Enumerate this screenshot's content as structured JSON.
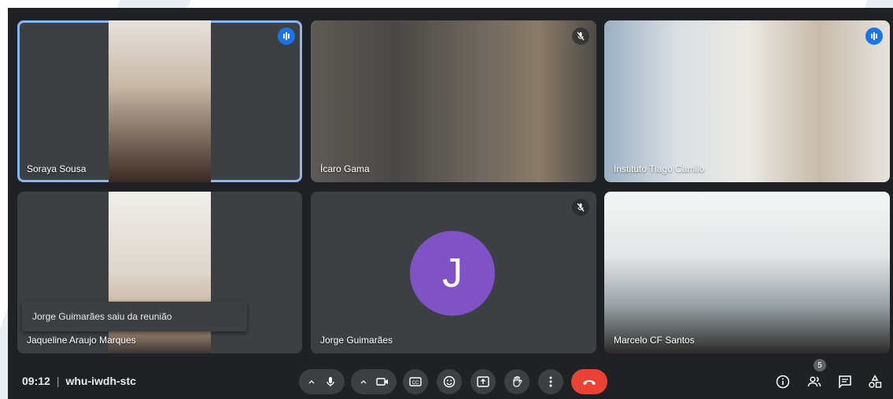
{
  "participants": [
    {
      "name": "Soraya Sousa"
    },
    {
      "name": "Ícaro Gama"
    },
    {
      "name": "Instituto Tiago Camilo"
    },
    {
      "name": "Jaqueline Araujo Marques"
    },
    {
      "name": "Jorge Guimarães",
      "initial": "J"
    },
    {
      "name": "Marcelo CF Santos"
    }
  ],
  "notification": "Jorge Guimarães saiu da reunião",
  "meeting": {
    "time": "09:12",
    "separator": "|",
    "code": "whu-iwdh-stc"
  },
  "people_count": "5",
  "colors": {
    "accent": "#1a73e8",
    "end_call": "#ea4335",
    "avatar": "#7f53c6",
    "active_border": "#8ab4f8"
  },
  "icons": [
    "speaking-icon",
    "mic-muted-icon",
    "chevron-up-icon",
    "mic-icon",
    "camera-icon",
    "captions-icon",
    "emoji-icon",
    "present-icon",
    "raise-hand-icon",
    "more-options-icon",
    "end-call-icon",
    "info-icon",
    "people-icon",
    "chat-icon",
    "activities-icon"
  ]
}
